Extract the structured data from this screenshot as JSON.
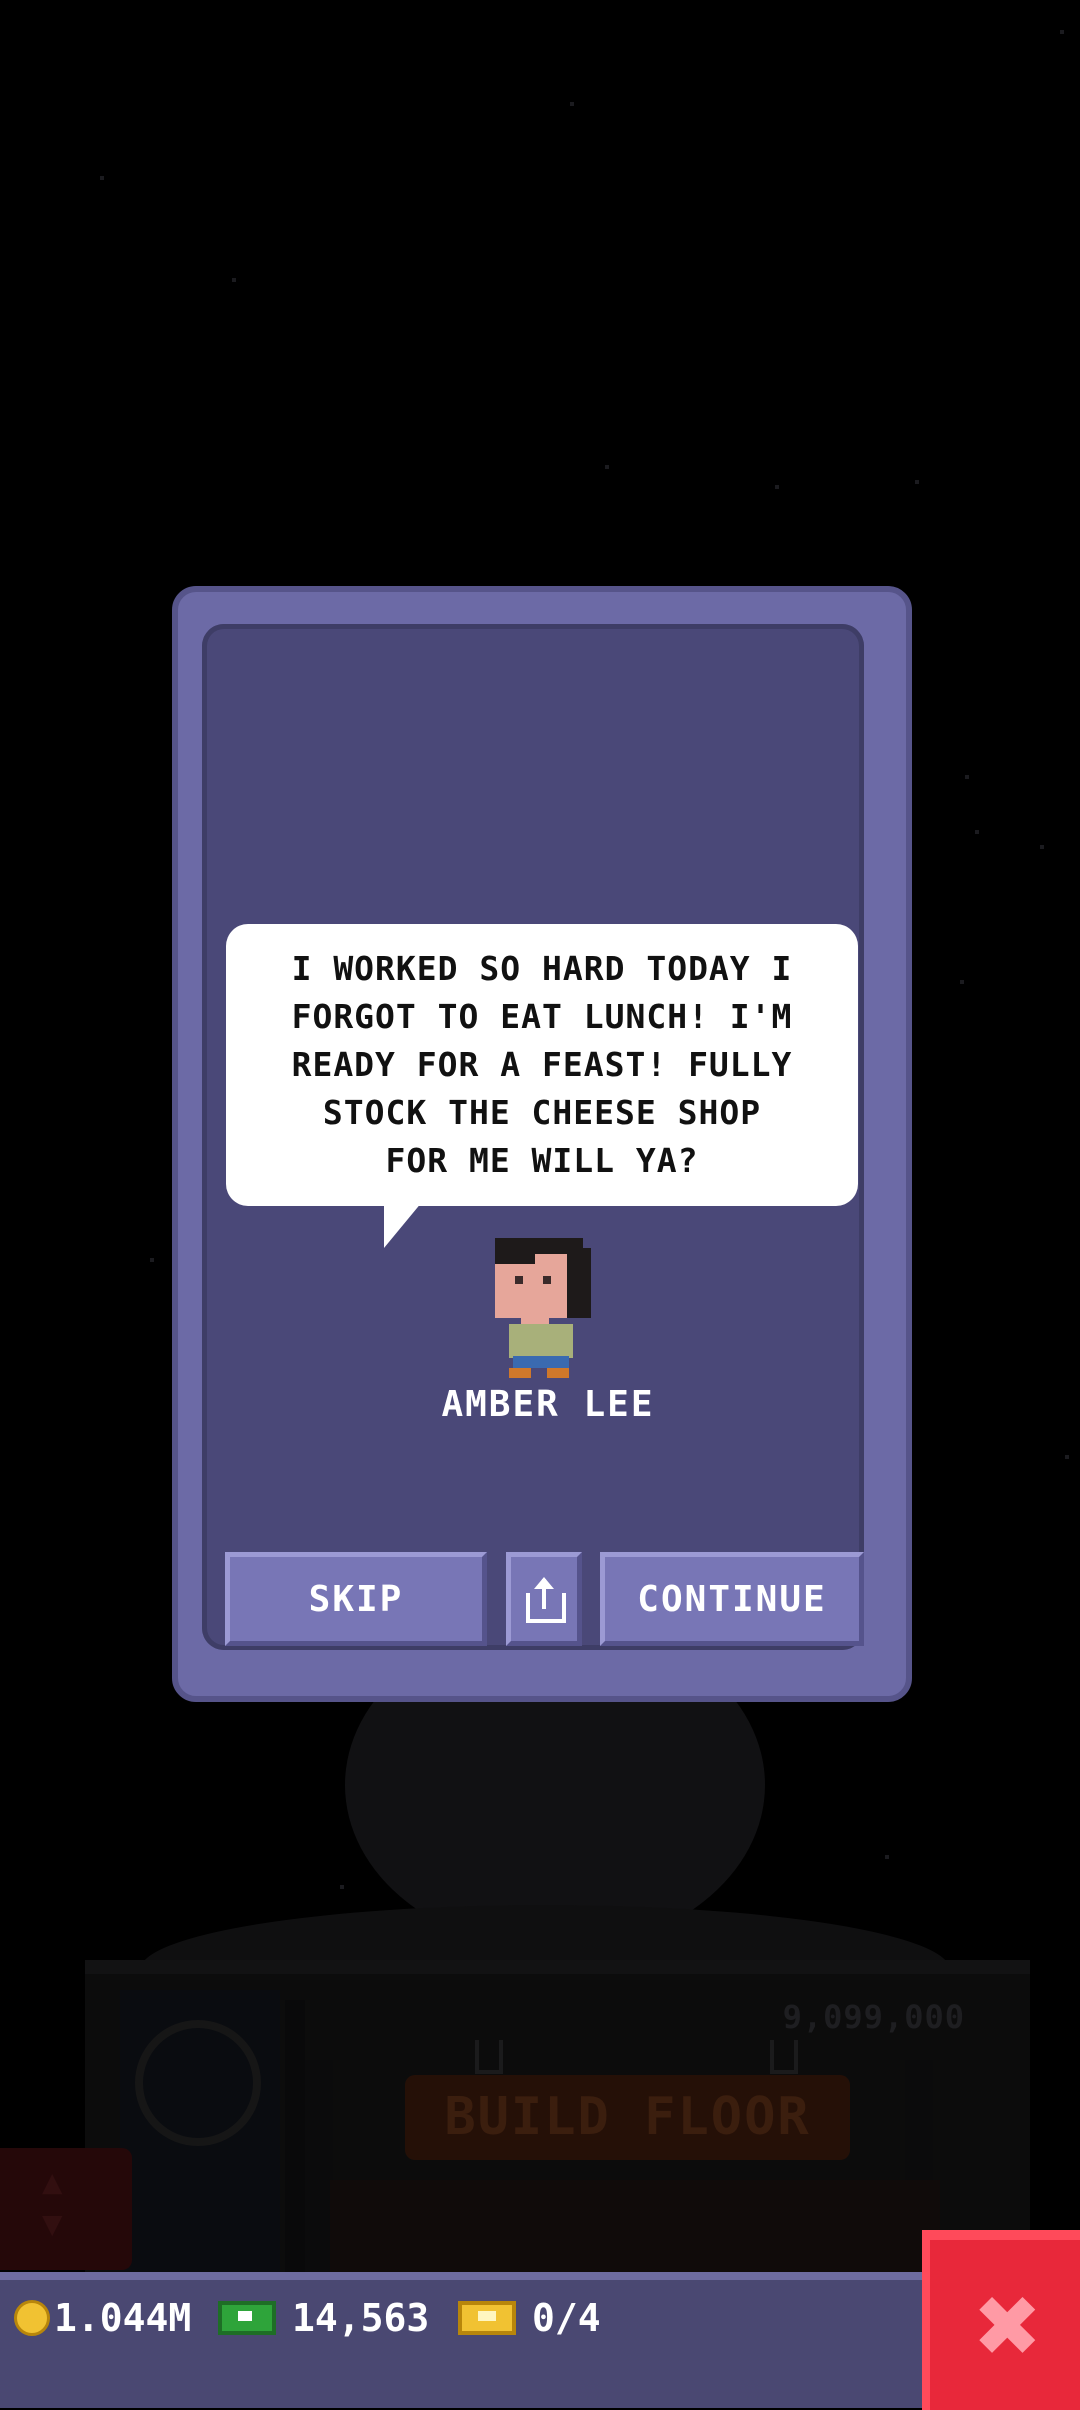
{
  "dialog": {
    "speech": "I WORKED SO HARD TODAY I\nFORGOT TO EAT LUNCH! I'M\nREADY FOR A FEAST! FULLY\nSTOCK THE CHEESE SHOP\nFOR ME WILL YA?",
    "character_name": "AMBER LEE",
    "skip_label": "SKIP",
    "continue_label": "CONTINUE",
    "share_icon": "share-icon"
  },
  "background": {
    "floor_price": "9,099,000",
    "build_floor_label": "BUILD FLOOR"
  },
  "status_bar": {
    "coins": "1.044M",
    "coins_icon": "coin-icon",
    "bux": "14,563",
    "bux_icon": "cash-icon",
    "tickets": "0/4",
    "tickets_icon": "ticket-icon"
  },
  "colors": {
    "dialog_bg": "#4a4878",
    "dialog_border": "#6c6aa6",
    "button": "#7876b6",
    "close_button": "#e8283a",
    "bottom_bar": "#4a4872"
  }
}
